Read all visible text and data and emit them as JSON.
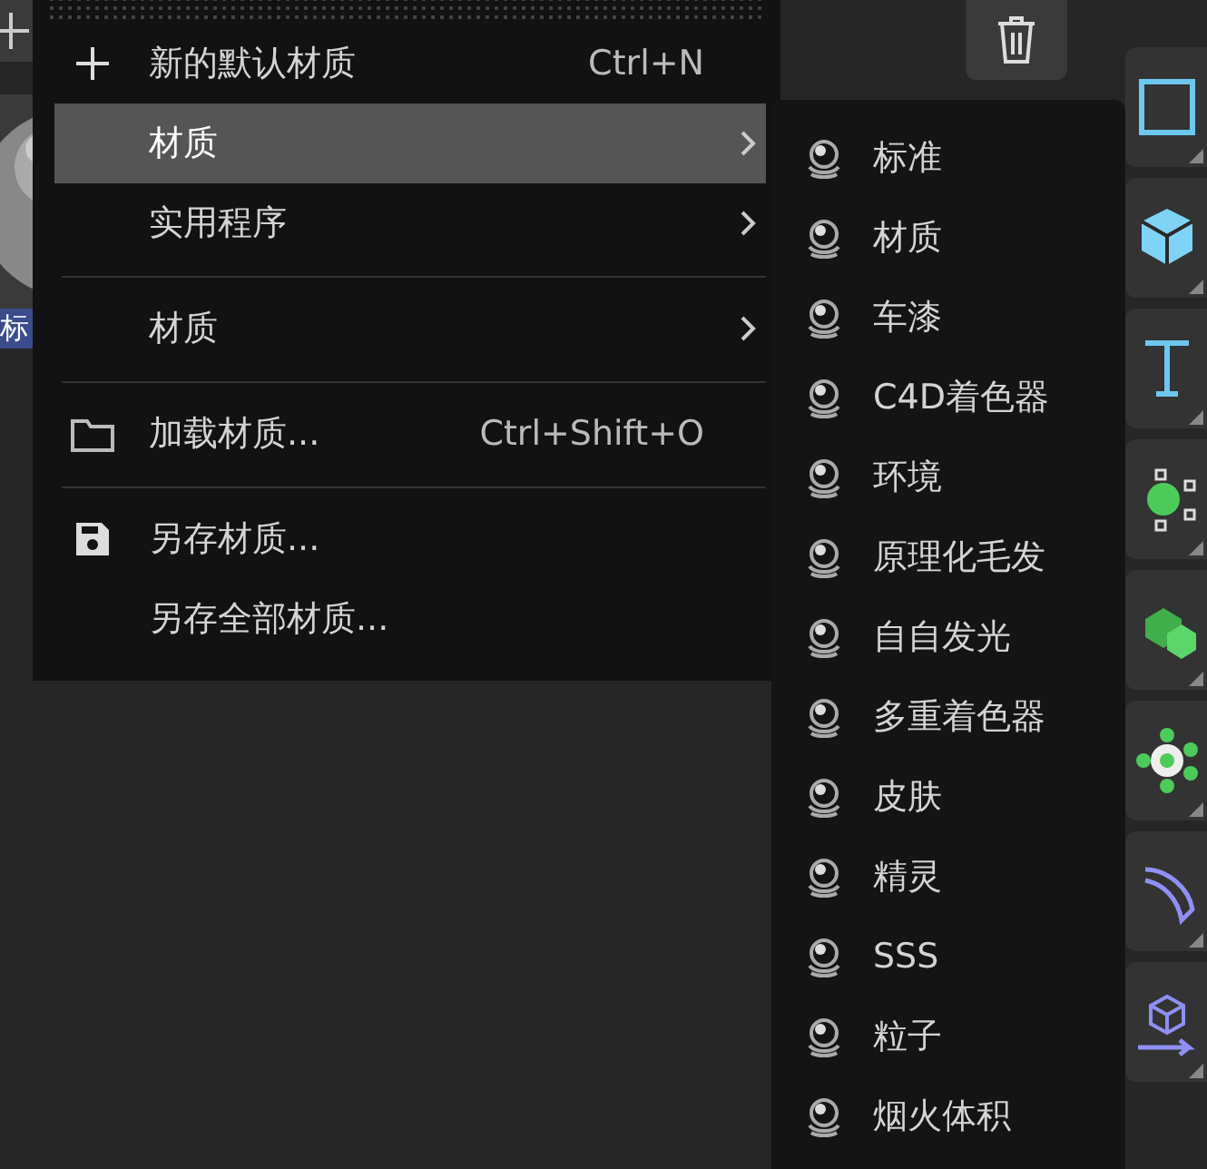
{
  "material_preview": {
    "label": "标"
  },
  "menu": {
    "items": [
      {
        "kind": "item",
        "label": "新的默认材质",
        "shortcut": "Ctrl+N",
        "submenu": false,
        "selected": false
      },
      {
        "kind": "item",
        "label": "材质",
        "submenu": true,
        "selected": true
      },
      {
        "kind": "item",
        "label": "实用程序",
        "submenu": true,
        "selected": false
      },
      {
        "kind": "separator"
      },
      {
        "kind": "item",
        "label": "材质",
        "submenu": true,
        "selected": false
      },
      {
        "kind": "separator"
      },
      {
        "kind": "item",
        "label": "加载材质...",
        "shortcut": "Ctrl+Shift+O",
        "submenu": false,
        "selected": false
      },
      {
        "kind": "separator"
      },
      {
        "kind": "item",
        "label": "另存材质...",
        "submenu": false,
        "selected": false
      },
      {
        "kind": "item",
        "label": "另存全部材质...",
        "submenu": false,
        "selected": false
      }
    ]
  },
  "submenu": {
    "items": [
      {
        "label": "标准"
      },
      {
        "label": "材质"
      },
      {
        "label": "车漆"
      },
      {
        "label": "C4D着色器"
      },
      {
        "label": "环境"
      },
      {
        "label": "原理化毛发"
      },
      {
        "label": "自自发光"
      },
      {
        "label": "多重着色器"
      },
      {
        "label": "皮肤"
      },
      {
        "label": "精灵"
      },
      {
        "label": "SSS"
      },
      {
        "label": "粒子"
      },
      {
        "label": "烟火体积"
      }
    ]
  }
}
